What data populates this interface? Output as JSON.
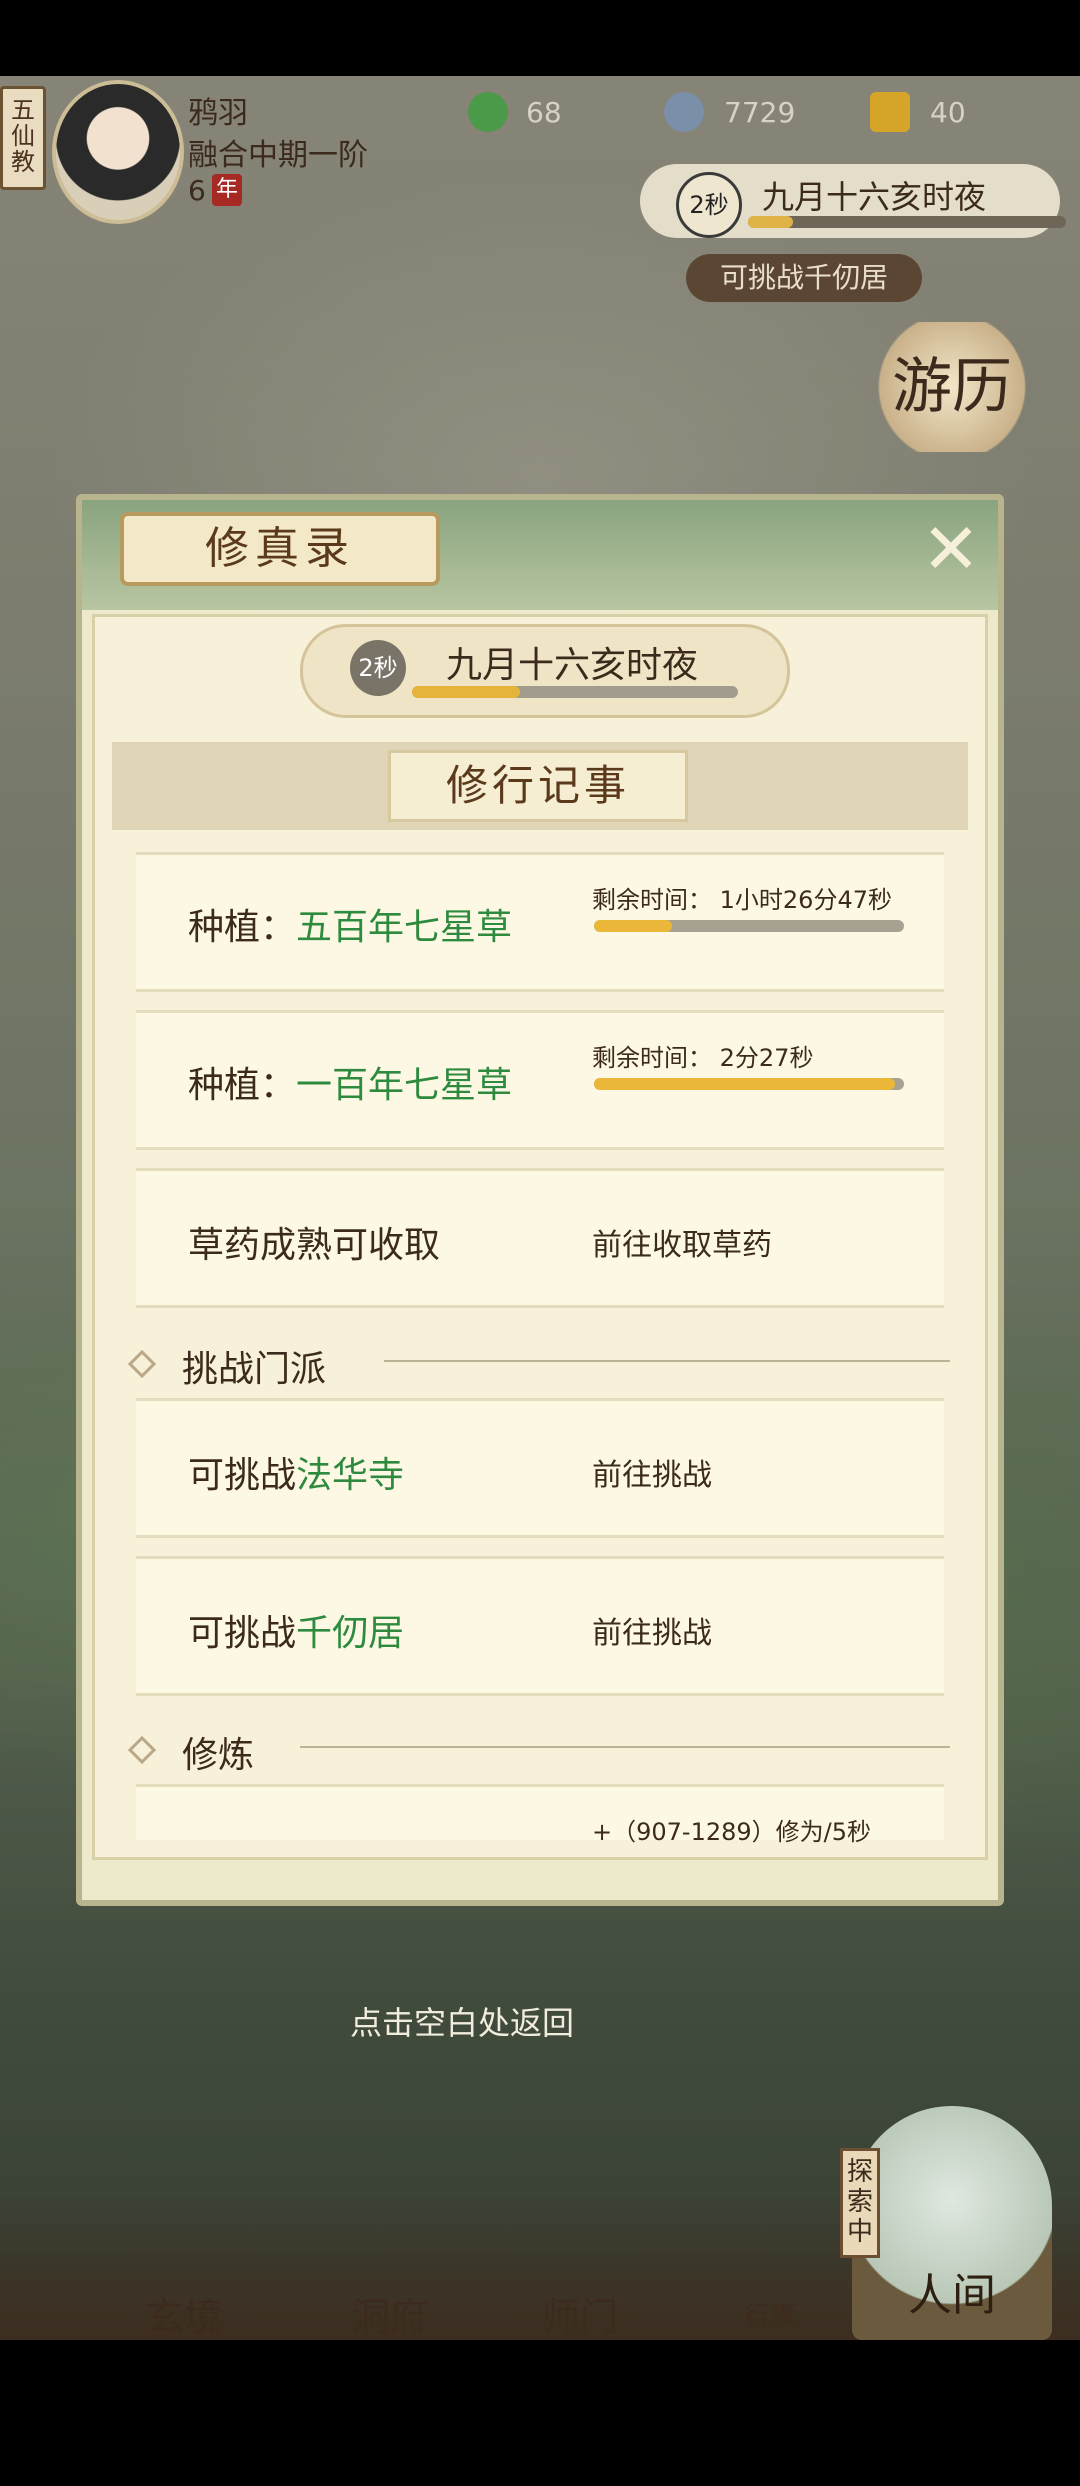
{
  "sect": {
    "label": "五仙教"
  },
  "character": {
    "name": "鸦羽",
    "realm": "融合中期一阶",
    "age_value": "6",
    "age_unit": "年"
  },
  "resources": [
    {
      "icon": "jade-icon",
      "value": "68"
    },
    {
      "icon": "coin-icon",
      "value": "7729"
    },
    {
      "icon": "gold-statue-icon",
      "value": "40"
    }
  ],
  "top_time": {
    "countdown": "2秒",
    "text": "九月十六亥时夜",
    "progress": 0.14
  },
  "top_challenge": {
    "label": "可挑战千仞居"
  },
  "youli": {
    "label": "游历"
  },
  "modal": {
    "title": "修真录",
    "time": {
      "countdown": "2秒",
      "text": "九月十六亥时夜",
      "progress": 0.33
    },
    "section_title": "修行记事",
    "plant_cards": [
      {
        "prefix": "种植：",
        "name": "五百年七星草",
        "remaining_label": "剩余时间：",
        "remaining_value": "1小时26分47秒",
        "progress": 0.25
      },
      {
        "prefix": "种植：",
        "name": "一百年七星草",
        "remaining_label": "剩余时间：",
        "remaining_value": "2分27秒",
        "progress": 0.97
      }
    ],
    "harvest_card": {
      "left": "草药成熟可收取",
      "right": "前往收取草药"
    },
    "challenge_header": "挑战门派",
    "challenge_cards": [
      {
        "prefix": "可挑战",
        "name": "法华寺",
        "action": "前往挑战"
      },
      {
        "prefix": "可挑战",
        "name": "千仞居",
        "action": "前往挑战"
      }
    ],
    "train_header": "修炼",
    "train_card": {
      "right": "+（907-1289）修为/5秒"
    }
  },
  "bottom_hint": "点击空白处返回",
  "nav": {
    "items": [
      "玄境",
      "洞府",
      "师门",
      "行囊"
    ],
    "explore_tag": "探索中",
    "renjian": "人间"
  }
}
